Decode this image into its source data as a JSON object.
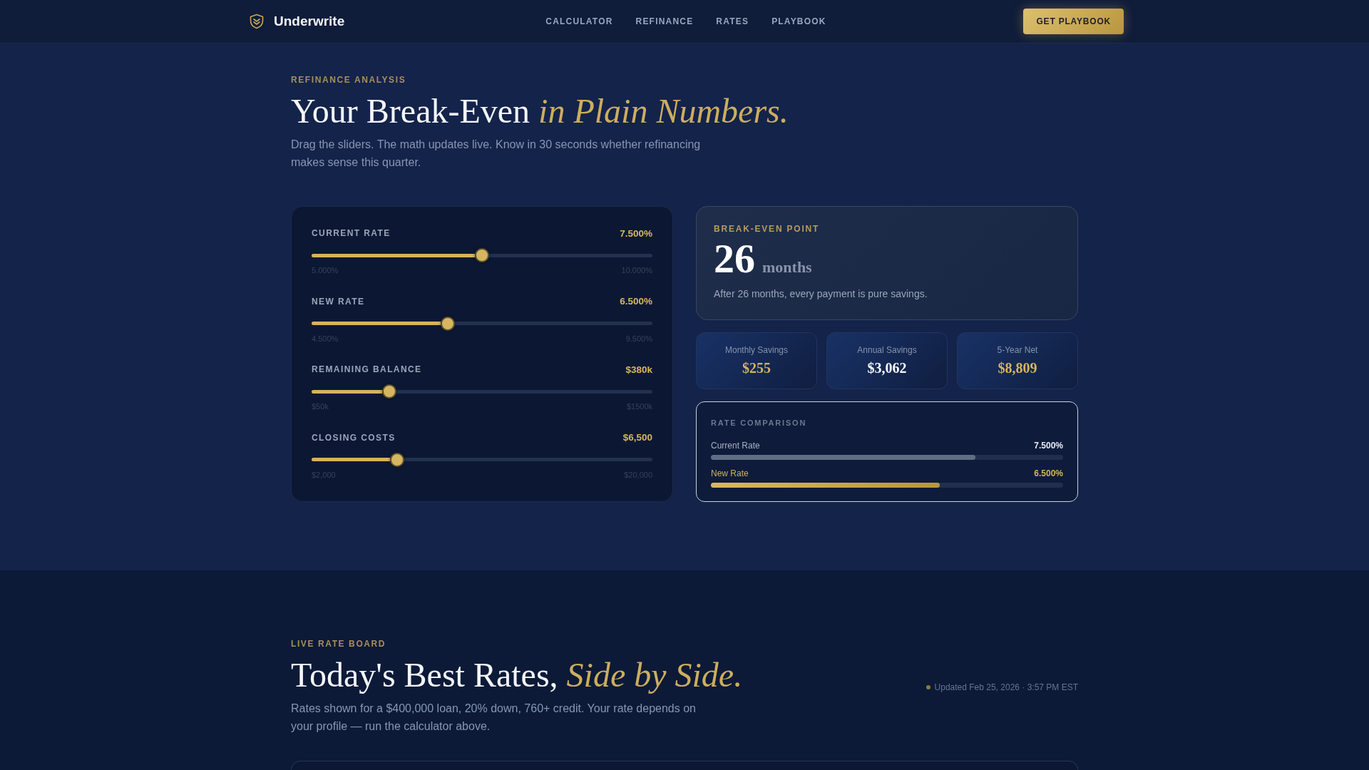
{
  "header": {
    "brand": "Underwrite",
    "nav": [
      {
        "label": "CALCULATOR"
      },
      {
        "label": "REFINANCE"
      },
      {
        "label": "RATES"
      },
      {
        "label": "PLAYBOOK"
      }
    ],
    "cta": "GET PLAYBOOK"
  },
  "hero": {
    "eyebrow": "REFINANCE ANALYSIS",
    "title": "Your Break-Even *in Plain Numbers.*",
    "subtitle": "Drag the sliders. The math updates live. Know in 30 seconds whether refinancing makes sense this quarter."
  },
  "sliders": [
    {
      "label": "CURRENT RATE",
      "value": "7.500%",
      "level": 0.5,
      "min": "5.000%",
      "max": "10.000%"
    },
    {
      "label": "NEW RATE",
      "value": "6.500%",
      "level": 0.4,
      "min": "4.500%",
      "max": "9.500%"
    },
    {
      "label": "REMAINING BALANCE",
      "value": "$380k",
      "level": 0.228,
      "min": "$50k",
      "max": "$1500k"
    },
    {
      "label": "CLOSING COSTS",
      "value": "$6,500",
      "level": 0.25,
      "min": "$2,000",
      "max": "$20,000"
    }
  ],
  "break_even": {
    "label": "BREAK-EVEN POINT",
    "number": "26",
    "unit": "months",
    "note": "After 26 months, every payment is pure savings."
  },
  "stats": [
    {
      "label": "Monthly Savings",
      "value": "$255",
      "accent": true
    },
    {
      "label": "Annual Savings",
      "value": "$3,062",
      "accent": false
    },
    {
      "label": "5-Year Net",
      "value": "$8,809",
      "accent": true
    }
  ],
  "rate_comparison": {
    "title": "RATE COMPARISON",
    "rows": [
      {
        "kind": "current",
        "label": "Current Rate",
        "value": "7.500%",
        "level": 0.75
      },
      {
        "kind": "new",
        "label": "New Rate",
        "value": "6.500%",
        "level": 0.65
      }
    ]
  },
  "rate_board": {
    "eyebrow": "LIVE RATE BOARD",
    "title": "Today's Best Rates, *Side by Side.*",
    "subtitle": "Rates shown for a $400,000 loan, 20% down, 760+ credit. Your rate depends on your profile — run the calculator above.",
    "updated": "Updated Feb 25, 2026 · 3:57 PM EST"
  }
}
